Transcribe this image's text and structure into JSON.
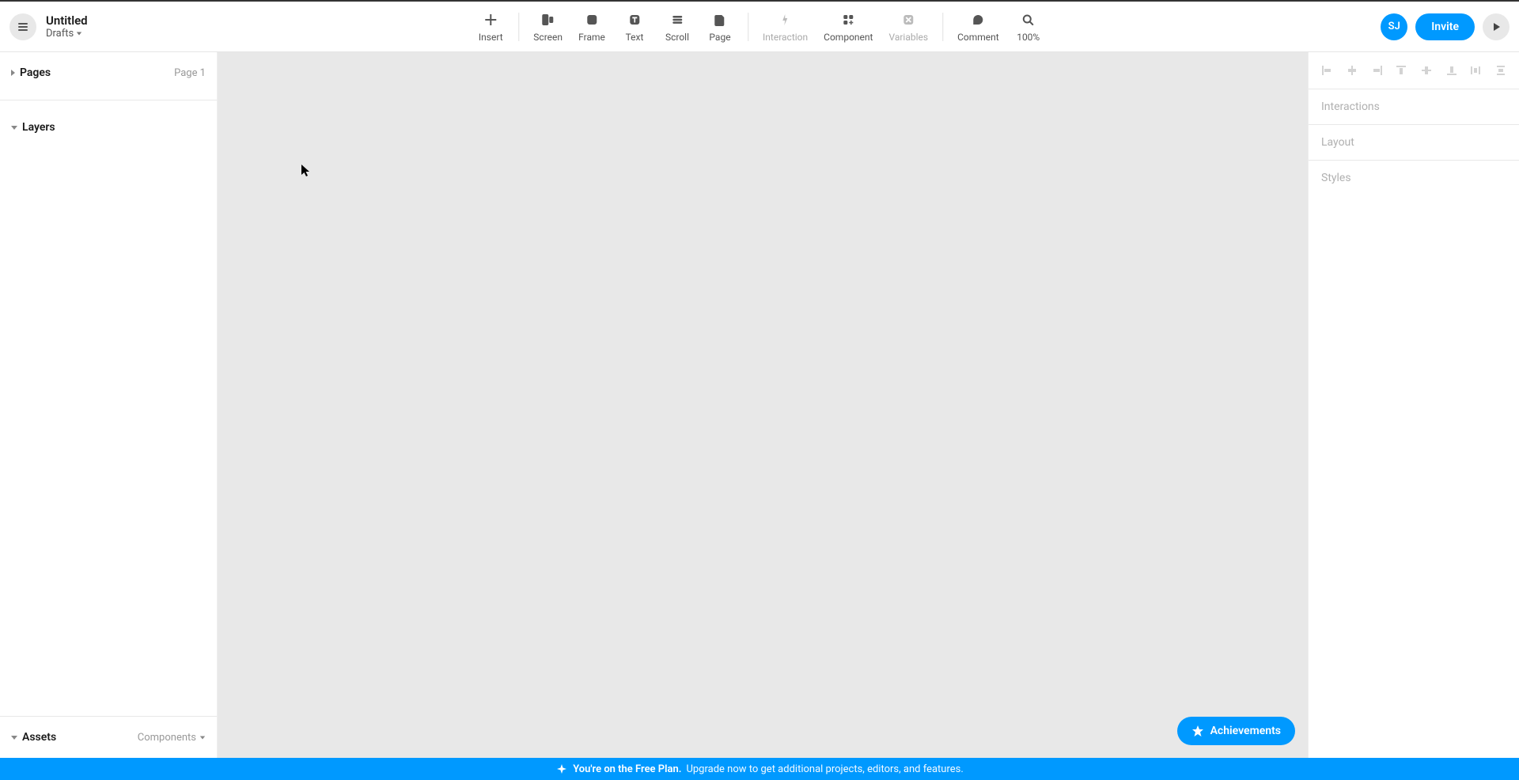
{
  "header": {
    "title": "Untitled",
    "location": "Drafts"
  },
  "toolbar": {
    "insert": "Insert",
    "screen": "Screen",
    "frame": "Frame",
    "text": "Text",
    "scroll": "Scroll",
    "page": "Page",
    "interaction": "Interaction",
    "component": "Component",
    "variables": "Variables",
    "comment": "Comment",
    "zoom": "100%"
  },
  "user": {
    "initials": "SJ",
    "invite_label": "Invite"
  },
  "left_panel": {
    "pages": {
      "title": "Pages",
      "current": "Page 1"
    },
    "layers": {
      "title": "Layers"
    },
    "assets": {
      "title": "Assets",
      "dropdown": "Components"
    }
  },
  "right_panel": {
    "interactions": "Interactions",
    "layout": "Layout",
    "styles": "Styles"
  },
  "achievements": {
    "label": "Achievements"
  },
  "banner": {
    "bold": "You're on the Free Plan.",
    "text": "Upgrade now to get additional projects, editors, and features."
  }
}
